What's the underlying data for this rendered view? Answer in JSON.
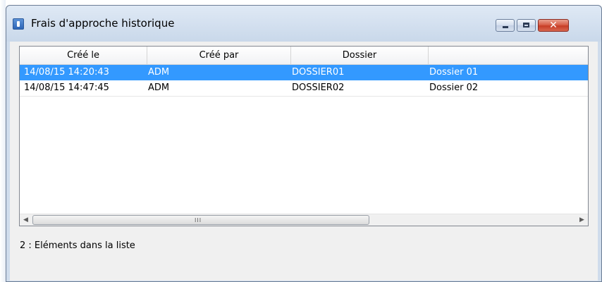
{
  "window": {
    "title": "Frais d'approche historique",
    "controls": {
      "minimize": "minimize",
      "maximize": "maximize",
      "close": "✕"
    }
  },
  "list": {
    "columns": [
      "Créé le",
      "Créé par",
      "Dossier",
      ""
    ],
    "rows": [
      [
        "14/08/15 14:20:43",
        "ADM",
        "DOSSIER01",
        "Dossier 01"
      ],
      [
        "14/08/15 14:47:45",
        "ADM",
        "DOSSIER02",
        "Dossier 02"
      ]
    ],
    "selected_row": 0,
    "scrollbar": {
      "left_arrow": "◀",
      "right_arrow": "▶",
      "grip": "III"
    }
  },
  "status": {
    "text": "2 : Eléments dans la liste"
  },
  "colors": {
    "selection": "#3399ff",
    "close_button": "#c73d26"
  }
}
